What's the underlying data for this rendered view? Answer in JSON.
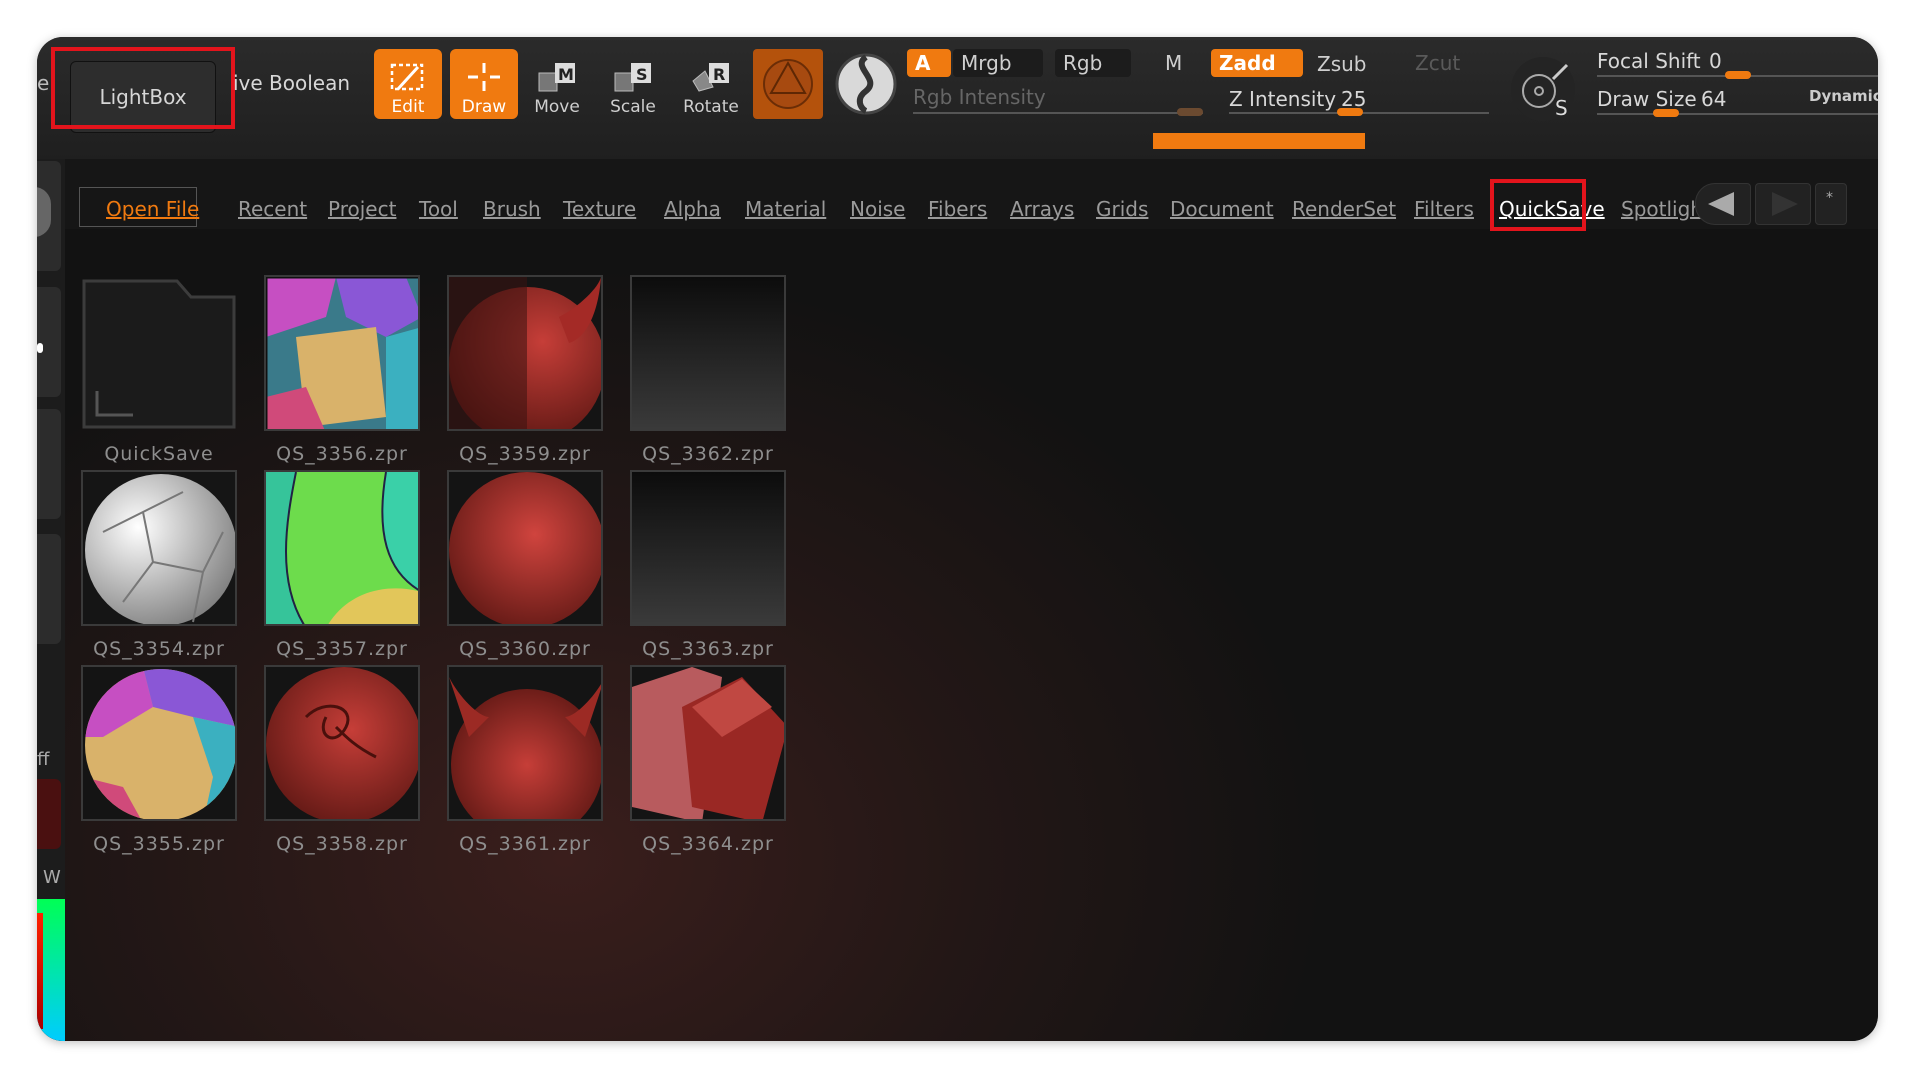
{
  "toolbar": {
    "left_edge_text": "e",
    "lightbox_label": "LightBox",
    "live_boolean_label": "ive Boolean",
    "tools": [
      {
        "label": "Edit",
        "active": true
      },
      {
        "label": "Draw",
        "active": true
      },
      {
        "label": "Move",
        "active": false
      },
      {
        "label": "Scale",
        "active": false
      },
      {
        "label": "Rotate",
        "active": false
      }
    ],
    "channel_a": "A",
    "mrgb": "Mrgb",
    "rgb": "Rgb",
    "m": "M",
    "zadd": "Zadd",
    "zsub": "Zsub",
    "zcut": "Zcut",
    "rgb_intensity_label": "Rgb Intensity",
    "z_intensity_label": "Z Intensity",
    "z_intensity_value": "25",
    "focal_shift_label": "Focal Shift",
    "focal_shift_value": "0",
    "draw_size_label": "Draw Size",
    "draw_size_value": "64",
    "dynamic_label": "Dynamic",
    "accent_color": "#f07a10"
  },
  "left_strip": {
    "partial_ff": "ff",
    "partial_w": "W"
  },
  "lightbox": {
    "tabs": [
      "Open File",
      "Recent",
      "Project",
      "Tool",
      "Brush",
      "Texture",
      "Alpha",
      "Material",
      "Noise",
      "Fibers",
      "Arrays",
      "Grids",
      "Document",
      "RenderSet",
      "Filters",
      "QuickSave",
      "Spotlight"
    ],
    "active_tab": "QuickSave",
    "files": [
      {
        "name": "QuickSave",
        "kind": "folder"
      },
      {
        "name": "QS_3356.zpr",
        "kind": "sphere-polygroups"
      },
      {
        "name": "QS_3359.zpr",
        "kind": "sphere-horn-split"
      },
      {
        "name": "QS_3362.zpr",
        "kind": "empty"
      },
      {
        "name": "QS_3354.zpr",
        "kind": "sphere-white"
      },
      {
        "name": "QS_3357.zpr",
        "kind": "sphere-green"
      },
      {
        "name": "QS_3360.zpr",
        "kind": "sphere-red"
      },
      {
        "name": "QS_3363.zpr",
        "kind": "empty"
      },
      {
        "name": "QS_3355.zpr",
        "kind": "sphere-polygroups"
      },
      {
        "name": "QS_3358.zpr",
        "kind": "sphere-sculpted"
      },
      {
        "name": "QS_3361.zpr",
        "kind": "sphere-horns"
      },
      {
        "name": "QS_3364.zpr",
        "kind": "cubes"
      }
    ]
  },
  "highlight_color": "#e3141c"
}
